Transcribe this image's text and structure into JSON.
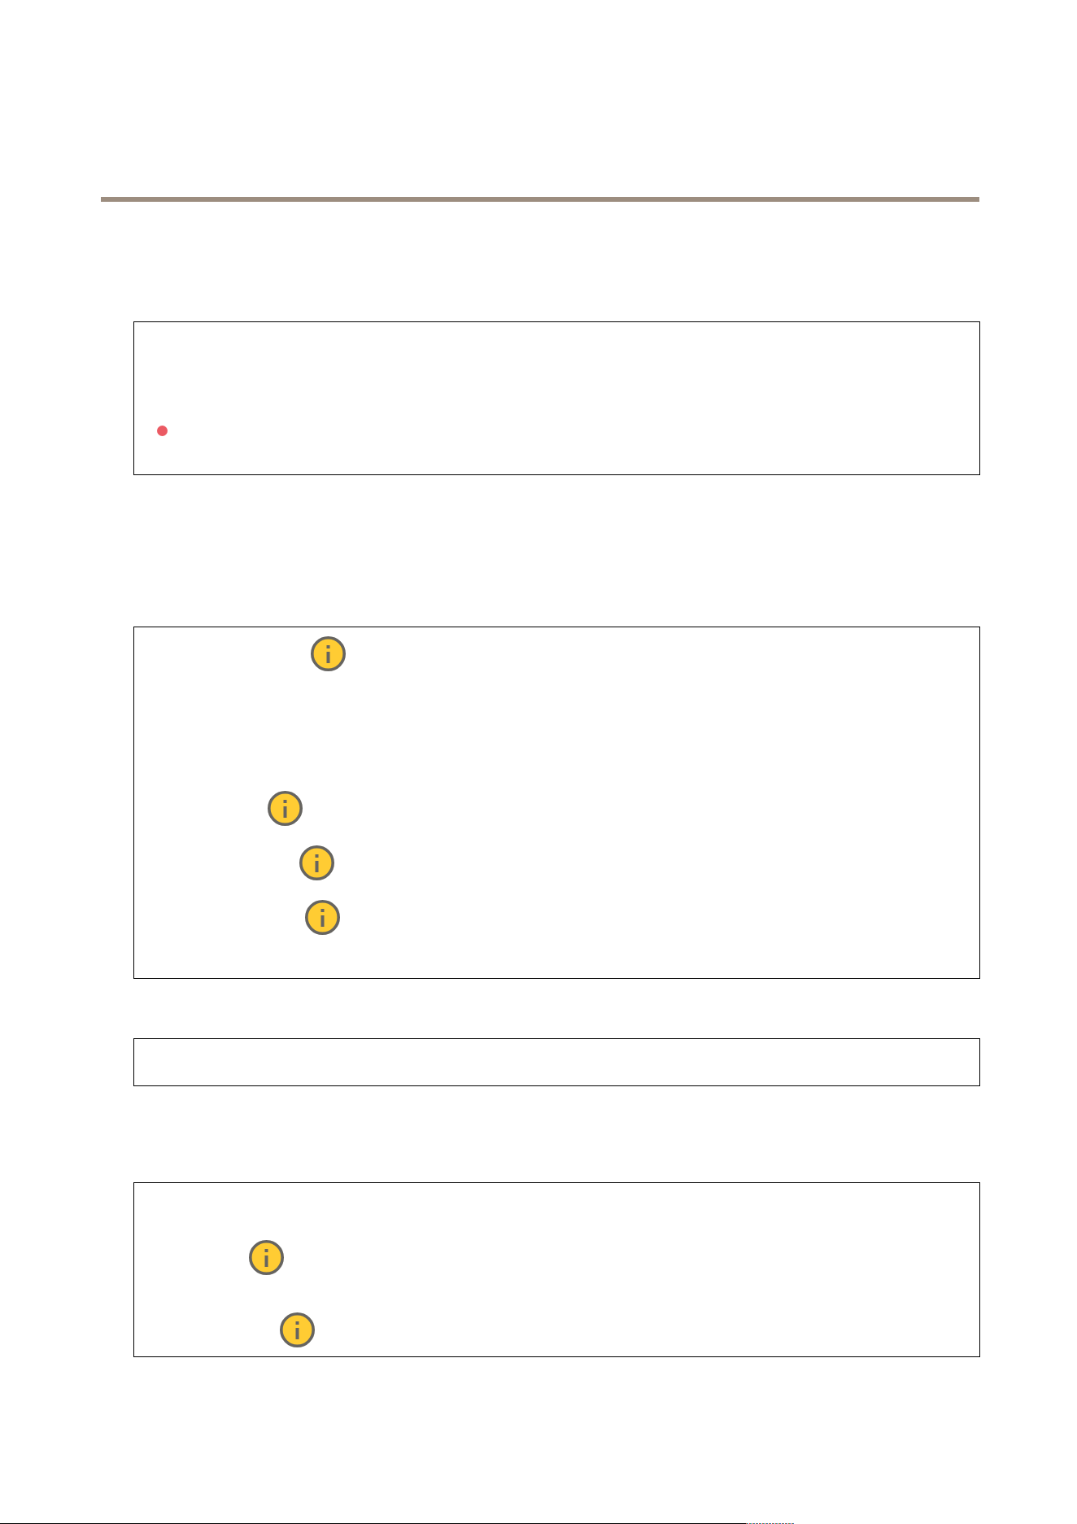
{
  "sections": [
    {
      "kind": "rule"
    },
    {
      "kind": "panel",
      "markers": [
        {
          "kind": "status_dot",
          "color": "#eb5a63"
        }
      ]
    },
    {
      "kind": "panel",
      "markers": [
        {
          "kind": "info"
        },
        {
          "kind": "info"
        },
        {
          "kind": "info"
        },
        {
          "kind": "info"
        }
      ]
    },
    {
      "kind": "panel"
    },
    {
      "kind": "panel",
      "markers": [
        {
          "kind": "info"
        },
        {
          "kind": "info"
        }
      ]
    },
    {
      "kind": "cut_line"
    }
  ]
}
